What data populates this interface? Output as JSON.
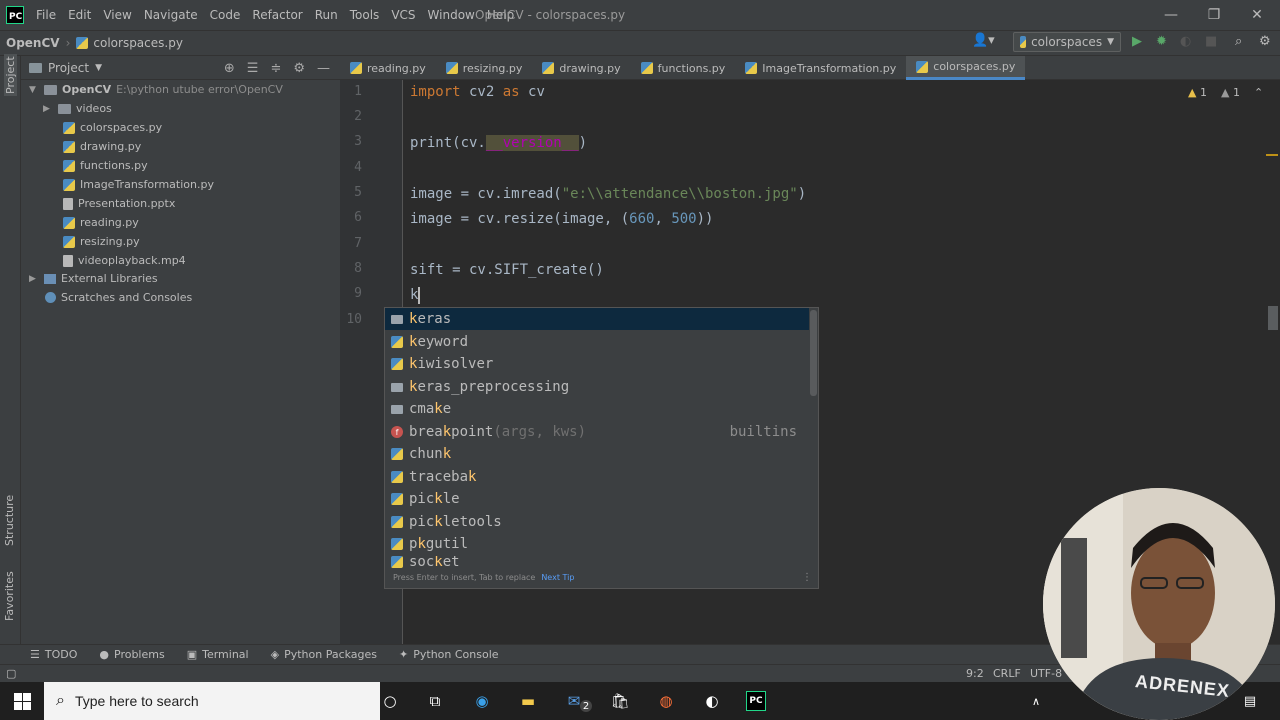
{
  "app": {
    "logo_text": "PC",
    "window_title": "OpenCV - colorspaces.py",
    "menu": [
      "File",
      "Edit",
      "View",
      "Navigate",
      "Code",
      "Refactor",
      "Run",
      "Tools",
      "VCS",
      "Window",
      "Help"
    ]
  },
  "navbar": {
    "project": "OpenCV",
    "file": "colorspaces.py",
    "run_config": "colorspaces"
  },
  "project_panel": {
    "title": "Project",
    "root_name": "OpenCV",
    "root_path": "E:\\python utube error\\OpenCV",
    "items": [
      {
        "label": "videos",
        "type": "folder"
      },
      {
        "label": "colorspaces.py",
        "type": "py"
      },
      {
        "label": "drawing.py",
        "type": "py"
      },
      {
        "label": "functions.py",
        "type": "py"
      },
      {
        "label": "ImageTransformation.py",
        "type": "py"
      },
      {
        "label": "Presentation.pptx",
        "type": "file"
      },
      {
        "label": "reading.py",
        "type": "py"
      },
      {
        "label": "resizing.py",
        "type": "py"
      },
      {
        "label": "videoplayback.mp4",
        "type": "file"
      }
    ],
    "external_libraries": "External Libraries",
    "scratches": "Scratches and Consoles"
  },
  "side_labels": {
    "project": "Project",
    "structure": "Structure",
    "favorites": "Favorites"
  },
  "editor_tabs": [
    {
      "label": "reading.py",
      "active": false
    },
    {
      "label": "resizing.py",
      "active": false
    },
    {
      "label": "drawing.py",
      "active": false
    },
    {
      "label": "functions.py",
      "active": false
    },
    {
      "label": "ImageTransformation.py",
      "active": false
    },
    {
      "label": "colorspaces.py",
      "active": true
    }
  ],
  "inspections": {
    "warnings": "1",
    "weak_warnings": "1"
  },
  "line_numbers": [
    "1",
    "2",
    "3",
    "4",
    "5",
    "6",
    "7",
    "8",
    "9",
    "10"
  ],
  "code": {
    "l1": {
      "kw1": "import",
      "mid": " cv2 ",
      "kw2": "as",
      "end": " cv"
    },
    "l3": {
      "pre": "print(cv.",
      "dunder": "__version__",
      "post": ")"
    },
    "l5": {
      "pre": "image = cv.imread(",
      "str": "\"e:\\\\attendance\\\\boston.jpg\"",
      "post": ")"
    },
    "l6": {
      "pre": "image = cv.resize(image, (",
      "n1": "660",
      "sep": ", ",
      "n2": "500",
      "post": "))"
    },
    "l8": {
      "text": "sift = cv.SIFT_create()"
    },
    "l9": {
      "text": "k"
    }
  },
  "completion": {
    "items": [
      {
        "pre": "",
        "match": "k",
        "post": "eras",
        "icon": "folder",
        "params": "",
        "type": ""
      },
      {
        "pre": "",
        "match": "k",
        "post": "eyword",
        "icon": "py",
        "params": "",
        "type": ""
      },
      {
        "pre": "",
        "match": "k",
        "post": "iwisolver",
        "icon": "py",
        "params": "",
        "type": ""
      },
      {
        "pre": "",
        "match": "k",
        "post": "eras_preprocessing",
        "icon": "folder",
        "params": "",
        "type": ""
      },
      {
        "pre": "cma",
        "match": "k",
        "post": "e",
        "icon": "folder",
        "params": "",
        "type": ""
      },
      {
        "pre": "brea",
        "match": "k",
        "post": "point",
        "icon": "func",
        "params": "(args, kws)",
        "type": "builtins"
      },
      {
        "pre": "chun",
        "match": "k",
        "post": "",
        "icon": "py",
        "params": "",
        "type": ""
      },
      {
        "pre": "traceba",
        "match": "k",
        "post": "",
        "icon": "py",
        "params": "",
        "type": ""
      },
      {
        "pre": "pic",
        "match": "k",
        "post": "le",
        "icon": "py",
        "params": "",
        "type": ""
      },
      {
        "pre": "pic",
        "match": "k",
        "post": "letools",
        "icon": "py",
        "params": "",
        "type": ""
      },
      {
        "pre": "p",
        "match": "k",
        "post": "gutil",
        "icon": "py",
        "params": "",
        "type": ""
      },
      {
        "pre": "soc",
        "match": "k",
        "post": "et",
        "icon": "py",
        "params": "",
        "type": ""
      }
    ],
    "footer_hint": "Press Enter to insert, Tab to replace",
    "footer_link": "Next Tip"
  },
  "tool_windows": [
    "TODO",
    "Problems",
    "Terminal",
    "Python Packages",
    "Python Console"
  ],
  "status": {
    "position": "9:2",
    "line_sep": "CRLF",
    "encoding": "UTF-8"
  },
  "taskbar": {
    "search_placeholder": "Type here to search",
    "mail_badge": "2"
  },
  "webcam": {
    "shirt_text": "ADRENEX"
  }
}
